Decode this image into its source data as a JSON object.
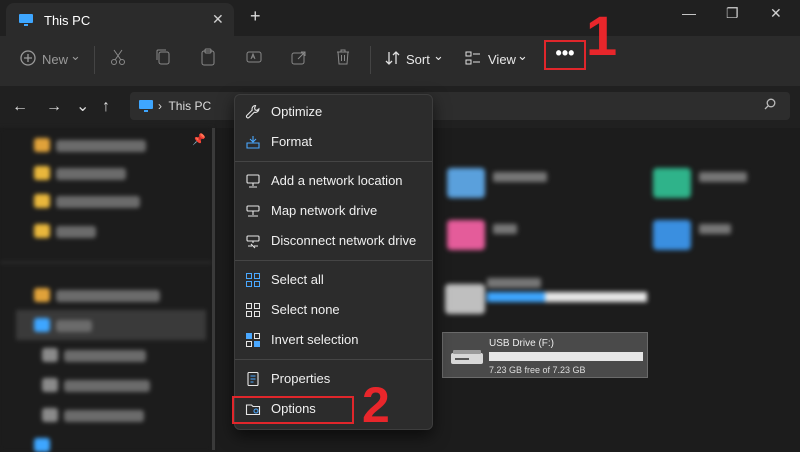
{
  "window": {
    "tab_title": "This PC",
    "close_tab": "✕",
    "new_tab": "+",
    "minimize": "—",
    "maximize": "❐",
    "close": "✕"
  },
  "toolbar": {
    "new_label": "New",
    "new_caret": "⌄",
    "sort_label": "Sort",
    "view_label": "View",
    "more_label": "•••"
  },
  "address": {
    "crumb": "This PC"
  },
  "annotations": {
    "step1": "1",
    "step2": "2",
    "color": "#e0262b"
  },
  "menu": {
    "items": [
      {
        "label": "Optimize",
        "icon": "wrench-icon"
      },
      {
        "label": "Format",
        "icon": "format-icon"
      },
      {
        "label": "Add a network location",
        "icon": "network-location-icon"
      },
      {
        "label": "Map network drive",
        "icon": "map-network-drive-icon"
      },
      {
        "label": "Disconnect network drive",
        "icon": "disconnect-network-drive-icon"
      },
      {
        "label": "Select all",
        "icon": "select-all-icon"
      },
      {
        "label": "Select none",
        "icon": "select-none-icon"
      },
      {
        "label": "Invert selection",
        "icon": "invert-selection-icon"
      },
      {
        "label": "Properties",
        "icon": "properties-icon"
      },
      {
        "label": "Options",
        "icon": "options-icon"
      }
    ]
  },
  "drive": {
    "name": "USB Drive (F:)",
    "free_text": "7.23 GB free of 7.23 GB",
    "used_fraction": 0
  }
}
